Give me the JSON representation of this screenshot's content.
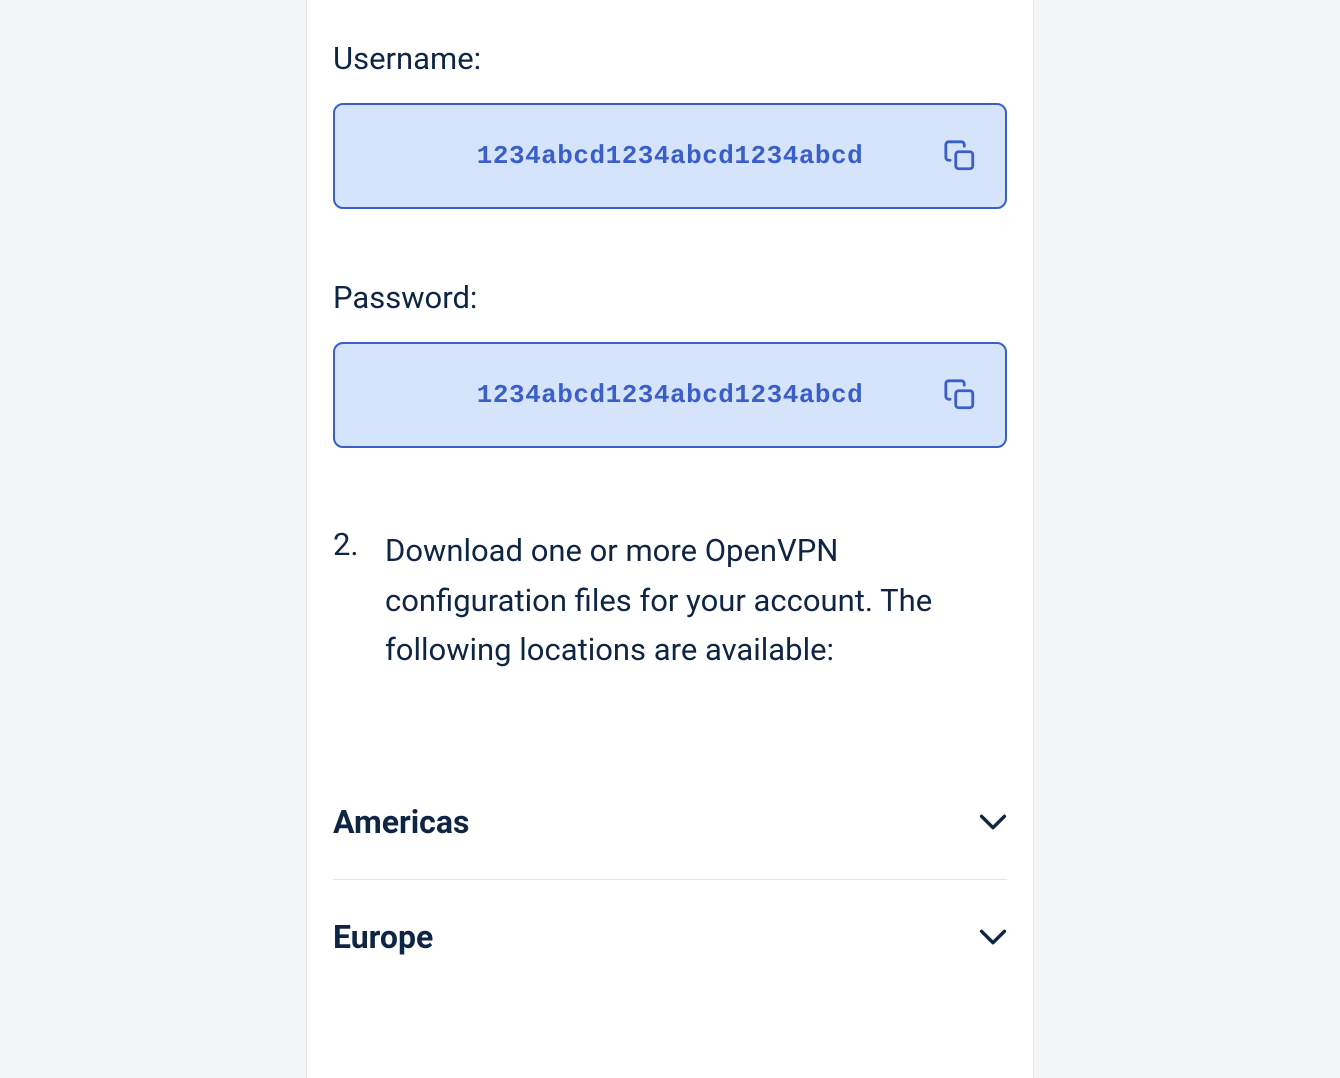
{
  "credentials": {
    "username_label": "Username:",
    "username_value": "1234abcd1234abcd1234abcd",
    "password_label": "Password:",
    "password_value": "1234abcd1234abcd1234abcd"
  },
  "step": {
    "number": "2.",
    "text": "Download one or more OpenVPN configuration files for your account. The following locations are available:"
  },
  "accordions": {
    "americas": "Americas",
    "europe": "Europe"
  }
}
